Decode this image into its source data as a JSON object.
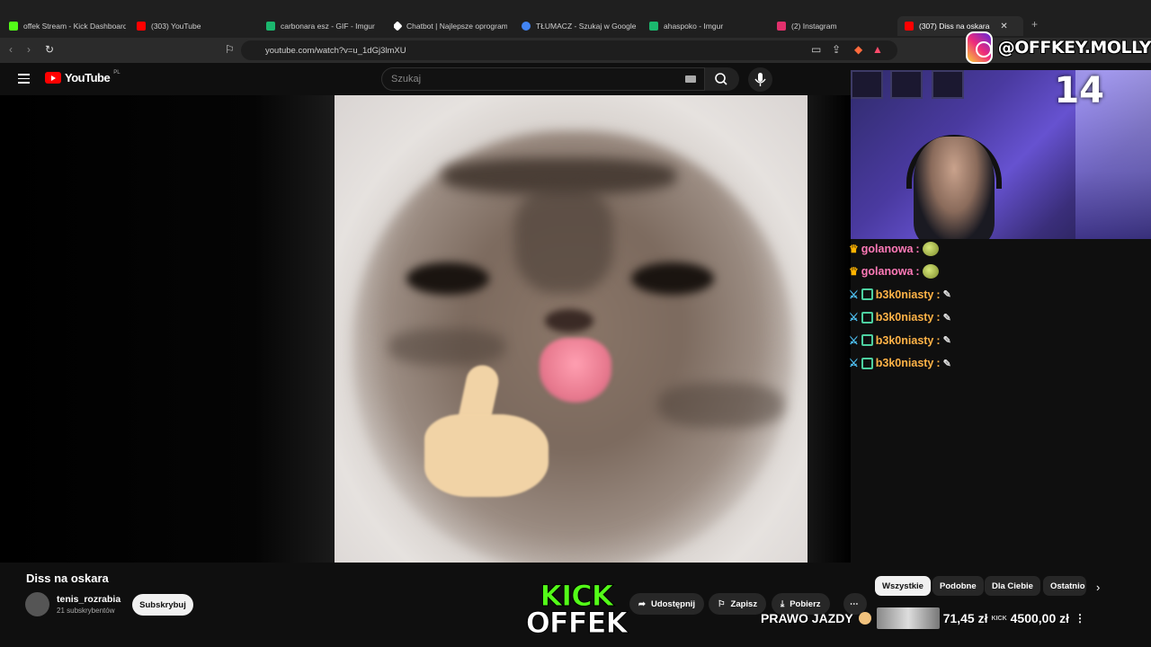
{
  "browser": {
    "tabs": [
      {
        "label": "offek Stream - Kick Dashboard",
        "color": "#53fc18"
      },
      {
        "label": "(303) YouTube",
        "color": "#ff0000"
      },
      {
        "label": "carbonara esz - GIF - Imgur",
        "color": "#1bb76e"
      },
      {
        "label": "Chatbot | Najlepsze oprogramo",
        "color": "#ffffff"
      },
      {
        "label": "TŁUMACZ - Szukaj w Google",
        "color": "#4285f4"
      },
      {
        "label": "ahaspoko - Imgur",
        "color": "#1bb76e"
      },
      {
        "label": "(2) Instagram",
        "color": "#e1306c"
      },
      {
        "label": "(307) Diss na oskara",
        "color": "#ff0000"
      }
    ],
    "url": "youtube.com/watch?v=u_1dGj3lmXU"
  },
  "youtube": {
    "logo_text": "YouTube",
    "region": "PL",
    "search_placeholder": "Szukaj",
    "video_title": "Diss na oskara",
    "channel_name": "tenis_rozrabia",
    "channel_subs": "21 subskrybentów",
    "subscribe_label": "Subskrybuj",
    "actions": {
      "share": "Udostępnij",
      "save": "Zapisz",
      "download": "Pobierz",
      "more": "⋯"
    },
    "chips": [
      "Wszystkie",
      "Podobne",
      "Dla Ciebie",
      "Ostatnio"
    ]
  },
  "overlay": {
    "instagram_handle": "@OFFKEY.MOLLY",
    "cam_number": "14",
    "kick_line1": "KICK",
    "kick_line2": "OFFEK",
    "ticker_text": "PRAWO JAZDY",
    "ticker_label": "KICK",
    "ticker_amount1": "71,45 zł",
    "ticker_amount2": "4500,00 zł"
  },
  "chat": [
    {
      "badge": "crown",
      "name": "golanowa",
      "color": "#ff7ab8",
      "emote": "frog"
    },
    {
      "badge": "crown",
      "name": "golanowa",
      "color": "#ff7ab8",
      "emote": "frog"
    },
    {
      "badge": "sword",
      "name": "b3k0niasty",
      "color": "#ffb347",
      "emote": "pen"
    },
    {
      "badge": "sword",
      "name": "b3k0niasty",
      "color": "#ffb347",
      "emote": "pen"
    },
    {
      "badge": "sword",
      "name": "b3k0niasty",
      "color": "#ffb347",
      "emote": "pen"
    },
    {
      "badge": "sword",
      "name": "b3k0niasty",
      "color": "#ffb347",
      "emote": "pen"
    }
  ]
}
